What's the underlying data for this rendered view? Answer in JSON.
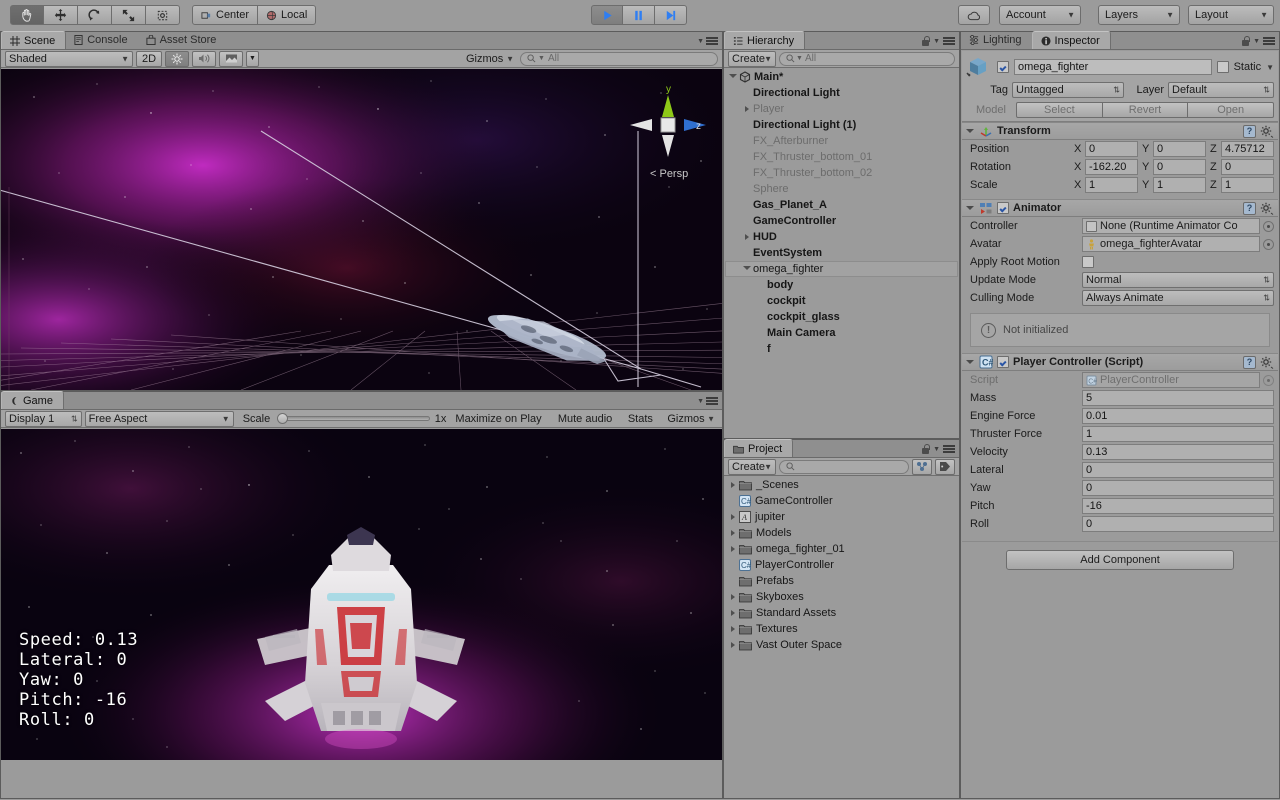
{
  "toolbar": {
    "tools": [
      {
        "name": "hand-tool",
        "glyph": "✋",
        "selected": true
      },
      {
        "name": "move-tool",
        "glyph": "✥",
        "selected": false
      },
      {
        "name": "rotate-tool",
        "glyph": "⟳",
        "selected": false
      },
      {
        "name": "scale-tool",
        "glyph": "⤡",
        "selected": false
      },
      {
        "name": "rect-tool",
        "glyph": "⬚",
        "selected": false
      }
    ],
    "pivot_label": "Center",
    "space_label": "Local",
    "play_label": "▶",
    "pause_label": "❚❚",
    "step_label": "▶❘",
    "cloud_label": "☁",
    "account_label": "Account",
    "layers_label": "Layers",
    "layout_label": "Layout",
    "accent_blue": "#2f7ef2"
  },
  "scene_view": {
    "tabs": [
      {
        "label": "Scene",
        "icon": "grid-icon",
        "active": true
      },
      {
        "label": "Console",
        "icon": "console-icon",
        "active": false
      },
      {
        "label": "Asset Store",
        "icon": "store-icon",
        "active": false
      }
    ],
    "draw_mode": "Shaded",
    "two_d_label": "2D",
    "light_icon": "sun-icon",
    "audio_icon": "speaker-icon",
    "fx_icon": "image-icon",
    "gizmos_label": "Gizmos",
    "search_placeholder": "All",
    "gizmo": {
      "y_label": "y",
      "z_label": "z",
      "persp_label": "Persp",
      "y_color": "#8ec918",
      "z_color": "#2f6fd0",
      "x_color": "#d04a4a"
    }
  },
  "game_view": {
    "tab_label": "Game",
    "display_label": "Display 1",
    "aspect_label": "Free Aspect",
    "scale_label": "Scale",
    "scale_value": "1x",
    "maximize_label": "Maximize on Play",
    "mute_label": "Mute audio",
    "stats_label": "Stats",
    "gizmos_label": "Gizmos",
    "hud": [
      "Speed: 0.13",
      "Lateral: 0",
      "Yaw: 0",
      "Pitch: -16",
      "Roll: 0"
    ]
  },
  "hierarchy": {
    "tab_label": "Hierarchy",
    "create_label": "Create",
    "search_placeholder": "All",
    "items": [
      {
        "label": "Main*",
        "depth": 0,
        "arrow": "open",
        "bold": true,
        "inactive": false,
        "selected": false,
        "icon": "scene-icon"
      },
      {
        "label": "Directional Light",
        "depth": 1,
        "arrow": "none",
        "bold": true,
        "inactive": false,
        "selected": false
      },
      {
        "label": "Player",
        "depth": 1,
        "arrow": "closed",
        "bold": false,
        "inactive": true,
        "selected": false
      },
      {
        "label": "Directional Light (1)",
        "depth": 1,
        "arrow": "none",
        "bold": true,
        "inactive": false,
        "selected": false
      },
      {
        "label": "FX_Afterburner",
        "depth": 1,
        "arrow": "none",
        "bold": false,
        "inactive": true,
        "selected": false
      },
      {
        "label": "FX_Thruster_bottom_01",
        "depth": 1,
        "arrow": "none",
        "bold": false,
        "inactive": true,
        "selected": false
      },
      {
        "label": "FX_Thruster_bottom_02",
        "depth": 1,
        "arrow": "none",
        "bold": false,
        "inactive": true,
        "selected": false
      },
      {
        "label": "Sphere",
        "depth": 1,
        "arrow": "none",
        "bold": false,
        "inactive": true,
        "selected": false
      },
      {
        "label": "Gas_Planet_A",
        "depth": 1,
        "arrow": "none",
        "bold": true,
        "inactive": false,
        "selected": false
      },
      {
        "label": "GameController",
        "depth": 1,
        "arrow": "none",
        "bold": true,
        "inactive": false,
        "selected": false
      },
      {
        "label": "HUD",
        "depth": 1,
        "arrow": "closed",
        "bold": true,
        "inactive": false,
        "selected": false
      },
      {
        "label": "EventSystem",
        "depth": 1,
        "arrow": "none",
        "bold": true,
        "inactive": false,
        "selected": false
      },
      {
        "label": "omega_fighter",
        "depth": 1,
        "arrow": "open",
        "bold": false,
        "inactive": false,
        "selected": true
      },
      {
        "label": "body",
        "depth": 2,
        "arrow": "none",
        "bold": true,
        "inactive": false,
        "selected": false
      },
      {
        "label": "cockpit",
        "depth": 2,
        "arrow": "none",
        "bold": true,
        "inactive": false,
        "selected": false
      },
      {
        "label": "cockpit_glass",
        "depth": 2,
        "arrow": "none",
        "bold": true,
        "inactive": false,
        "selected": false
      },
      {
        "label": "Main Camera",
        "depth": 2,
        "arrow": "none",
        "bold": true,
        "inactive": false,
        "selected": false
      },
      {
        "label": "f",
        "depth": 2,
        "arrow": "none",
        "bold": true,
        "inactive": false,
        "selected": false
      }
    ]
  },
  "project": {
    "tab_label": "Project",
    "create_label": "Create",
    "search_placeholder": "",
    "items": [
      {
        "label": "_Scenes",
        "arrow": "closed",
        "icon": "folder-icon"
      },
      {
        "label": "GameController",
        "arrow": "none",
        "icon": "cs-script-icon"
      },
      {
        "label": "jupiter",
        "arrow": "closed",
        "icon": "texture-icon"
      },
      {
        "label": "Models",
        "arrow": "closed",
        "icon": "folder-icon"
      },
      {
        "label": "omega_fighter_01",
        "arrow": "closed",
        "icon": "folder-icon"
      },
      {
        "label": "PlayerController",
        "arrow": "none",
        "icon": "cs-script-icon"
      },
      {
        "label": "Prefabs",
        "arrow": "none",
        "icon": "folder-icon"
      },
      {
        "label": "Skyboxes",
        "arrow": "closed",
        "icon": "folder-icon"
      },
      {
        "label": "Standard Assets",
        "arrow": "closed",
        "icon": "folder-icon"
      },
      {
        "label": "Textures",
        "arrow": "closed",
        "icon": "folder-icon"
      },
      {
        "label": "Vast Outer Space",
        "arrow": "closed",
        "icon": "folder-icon"
      }
    ]
  },
  "inspector": {
    "tabs": [
      {
        "label": "Lighting",
        "icon": "lighting-icon",
        "active": false
      },
      {
        "label": "Inspector",
        "icon": "info-icon",
        "active": true
      }
    ],
    "object_name": "omega_fighter",
    "object_enabled": true,
    "static_label": "Static",
    "static_checked": false,
    "tag_label": "Tag",
    "tag_value": "Untagged",
    "layer_label": "Layer",
    "layer_value": "Default",
    "model_label": "Model",
    "select_label": "Select",
    "revert_label": "Revert",
    "open_label": "Open",
    "transform": {
      "title": "Transform",
      "rows": [
        {
          "label": "Position",
          "x": "0",
          "y": "0",
          "z": "4.75712"
        },
        {
          "label": "Rotation",
          "x": "-162.20",
          "y": "0",
          "z": "0"
        },
        {
          "label": "Scale",
          "x": "1",
          "y": "1",
          "z": "1"
        }
      ],
      "axis_labels": [
        "X",
        "Y",
        "Z"
      ]
    },
    "animator": {
      "title": "Animator",
      "enabled": true,
      "controller_label": "Controller",
      "controller_value": "None (Runtime Animator Co",
      "avatar_label": "Avatar",
      "avatar_value": "omega_fighterAvatar",
      "root_motion_label": "Apply Root Motion",
      "root_motion_checked": false,
      "update_mode_label": "Update Mode",
      "update_mode_value": "Normal",
      "culling_mode_label": "Culling Mode",
      "culling_mode_value": "Always Animate",
      "help_text": "Not initialized"
    },
    "player_controller": {
      "title": "Player Controller (Script)",
      "enabled": true,
      "script_label": "Script",
      "script_value": "PlayerController",
      "fields": [
        {
          "label": "Mass",
          "value": "5"
        },
        {
          "label": "Engine Force",
          "value": "0.01"
        },
        {
          "label": "Thruster Force",
          "value": "1"
        },
        {
          "label": "Velocity",
          "value": "0.13"
        },
        {
          "label": "Lateral",
          "value": "0"
        },
        {
          "label": "Yaw",
          "value": "0"
        },
        {
          "label": "Pitch",
          "value": "-16"
        },
        {
          "label": "Roll",
          "value": "0"
        }
      ]
    },
    "add_component_label": "Add Component"
  }
}
